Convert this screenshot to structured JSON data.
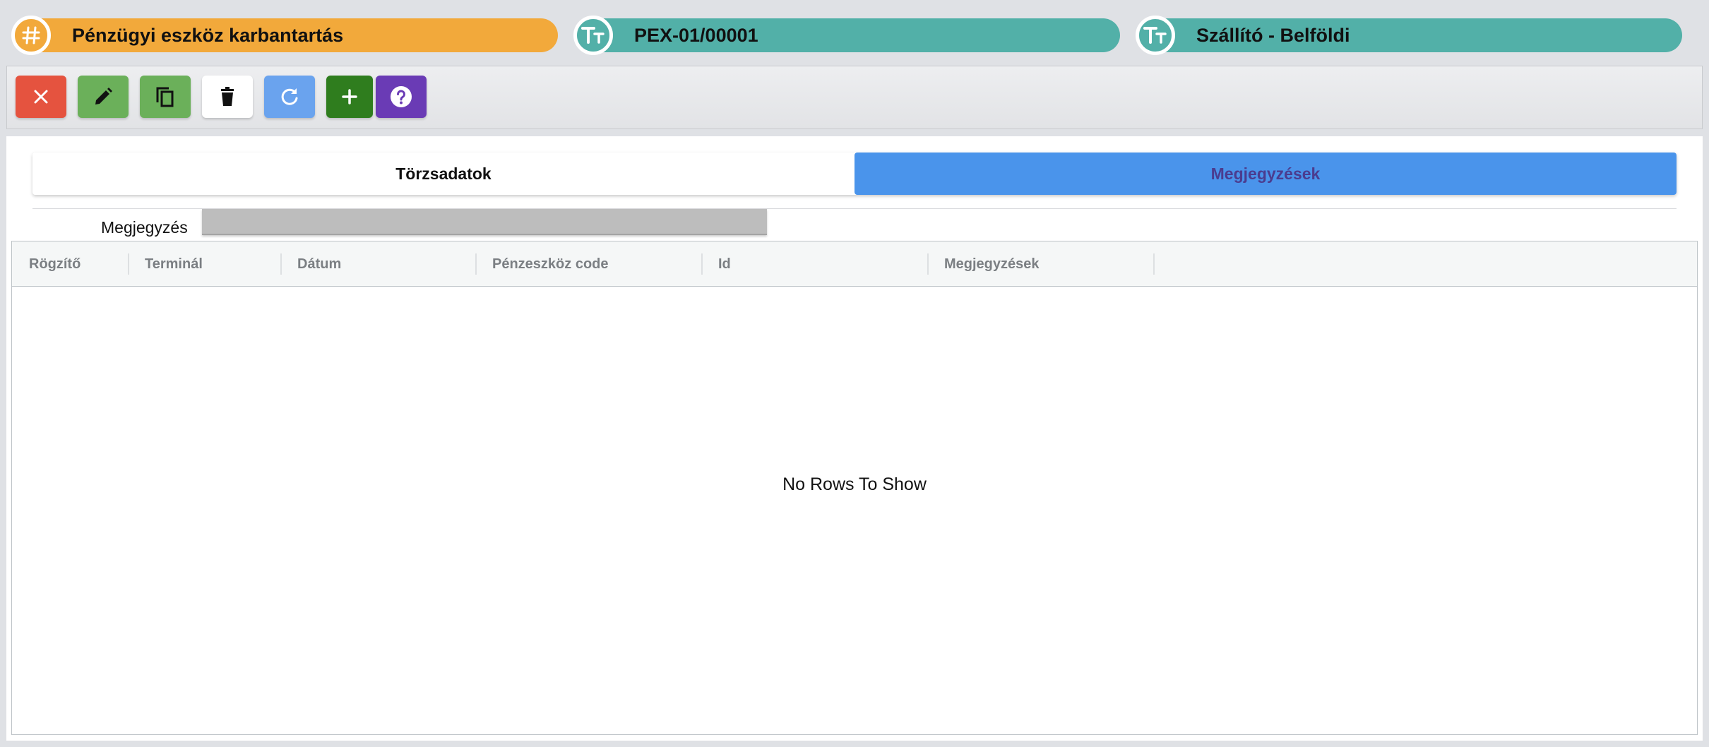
{
  "header": {
    "form_title": "Pénzügyi eszköz karbantartás",
    "record_code": "PEX-01/00001",
    "record_type": "Szállító - Belföldi",
    "colors": {
      "form_title": "#f2a93b",
      "record": "#52b0a8"
    }
  },
  "toolbar": {
    "buttons": [
      {
        "name": "close",
        "icon": "close-icon",
        "color": "#e5533f"
      },
      {
        "name": "edit",
        "icon": "pencil-icon",
        "color": "#6bb05a"
      },
      {
        "name": "copy",
        "icon": "copy-icon",
        "color": "#6bb05a"
      },
      {
        "name": "delete",
        "icon": "trash-icon",
        "color": "#ffffff"
      },
      {
        "name": "refresh",
        "icon": "refresh-icon",
        "color": "#6aa3ee"
      },
      {
        "name": "add",
        "icon": "plus-icon",
        "color": "#2f7d1e"
      },
      {
        "name": "help",
        "icon": "question-icon",
        "color": "#6a3bb5"
      }
    ]
  },
  "tabs": [
    {
      "label": "Törzsadatok",
      "active": false
    },
    {
      "label": "Megjegyzések",
      "active": true
    }
  ],
  "note": {
    "label": "Megjegyzés",
    "value": ""
  },
  "grid": {
    "columns": [
      "Rögzítő",
      "Terminál",
      "Dátum",
      "Pénzeszköz code",
      "Id",
      "Megjegyzések"
    ],
    "rows": [],
    "empty_text": "No Rows To Show"
  }
}
